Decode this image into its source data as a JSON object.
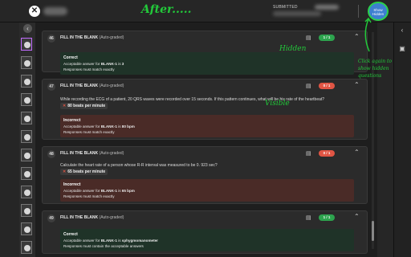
{
  "topbar": {
    "close_icon": "close-icon",
    "submitted_label": "SUBMITTED",
    "show_hidden_line1": "Show",
    "show_hidden_line2": "Hidden"
  },
  "annotations": {
    "after": "After.....",
    "hidden": "Hidden",
    "visible": "Visible",
    "click_note": "Click again to show hidden questions"
  },
  "colors": {
    "correct_bg": "#1f3328",
    "incorrect_bg": "#4a2b27",
    "score_green": "#2da44e",
    "score_red": "#e05544",
    "annotation": "#22c93a",
    "show_hidden_btn": "#3d7fd0"
  },
  "questions": [
    {
      "number": "46",
      "type": "FILL IN THE BLANK",
      "autograded": "(Auto-graded)",
      "score": "1 / 1",
      "score_status": "correct",
      "feedback_title": "Correct",
      "feedback_line1_pre": "Acceptable answer for ",
      "feedback_line1_blank": "BLANK-1",
      "feedback_line1_mid": " is ",
      "feedback_line1_answer": "3",
      "feedback_line2": "Responses must match exactly"
    },
    {
      "number": "47",
      "type": "FILL IN THE BLANK",
      "autograded": "(Auto-graded)",
      "score": "0 / 1",
      "score_status": "incorrect",
      "question_text": "While recording the ECG of a patient, 20 QRS waves were recorded over 15 seconds. If this pattern continues, what will be his rate of the heartbeat?",
      "student_answer": "80 beats per minute",
      "feedback_title": "Incorrect",
      "feedback_line1_pre": "Acceptable answer for ",
      "feedback_line1_blank": "BLANK-1",
      "feedback_line1_mid": " is ",
      "feedback_line1_answer": "80 bpm",
      "feedback_line2": "Responses must match exactly"
    },
    {
      "number": "48",
      "type": "FILL IN THE BLANK",
      "autograded": "(Auto-graded)",
      "score": "0 / 1",
      "score_status": "incorrect",
      "question_text": "Calculate the heart rate of a person whose R-R interval was measured to be 0. 923 sec?",
      "student_answer": "65 beats per minute",
      "feedback_title": "Incorrect",
      "feedback_line1_pre": "Acceptable answer for ",
      "feedback_line1_blank": "BLANK-1",
      "feedback_line1_mid": " is ",
      "feedback_line1_answer": "65 bpm",
      "feedback_line2": "Responses must match exactly"
    },
    {
      "number": "49",
      "type": "FILL IN THE BLANK",
      "autograded": "(Auto-graded)",
      "score": "1 / 1",
      "score_status": "correct",
      "feedback_title": "Correct",
      "feedback_line1_pre": "Acceptable answer for ",
      "feedback_line1_blank": "BLANK-1",
      "feedback_line1_mid": " is ",
      "feedback_line1_answer": "sphygmomanometer",
      "feedback_line2": "Responses must contain the acceptable answers"
    }
  ]
}
